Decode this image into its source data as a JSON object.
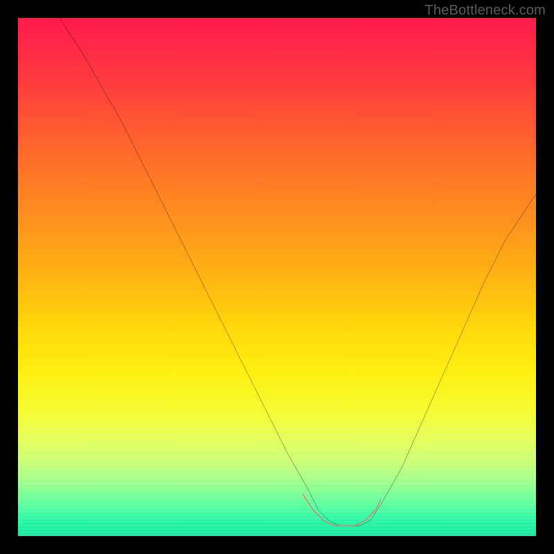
{
  "watermark": "TheBottleneck.com",
  "colors": {
    "background": "#000000",
    "curve_main": "#000000",
    "curve_highlight": "#e9746f",
    "gradient_top": "#ff1a4d",
    "gradient_bottom": "#18e8a2"
  },
  "chart_data": {
    "type": "line",
    "title": "",
    "xlabel": "",
    "ylabel": "",
    "xlim": [
      0,
      100
    ],
    "ylim": [
      0,
      100
    ],
    "series": [
      {
        "name": "bottleneck-curve",
        "x": [
          8,
          12,
          16,
          20,
          24,
          28,
          32,
          36,
          40,
          44,
          48,
          52,
          56,
          58,
          60,
          62,
          64,
          66,
          68,
          70,
          74,
          78,
          82,
          86,
          90,
          94,
          98,
          100
        ],
        "values": [
          100,
          94,
          87,
          80,
          72,
          64,
          56,
          48,
          40,
          32,
          24,
          16,
          9,
          5,
          3,
          2,
          2,
          2,
          3,
          6,
          13,
          22,
          31,
          40,
          49,
          57,
          63,
          66
        ]
      }
    ],
    "highlight": {
      "name": "valley-highlight",
      "x": [
        55,
        57,
        59,
        61,
        63,
        65,
        67,
        69,
        70
      ],
      "values": [
        8,
        5,
        3,
        2,
        2,
        2,
        3,
        5,
        7
      ]
    }
  }
}
